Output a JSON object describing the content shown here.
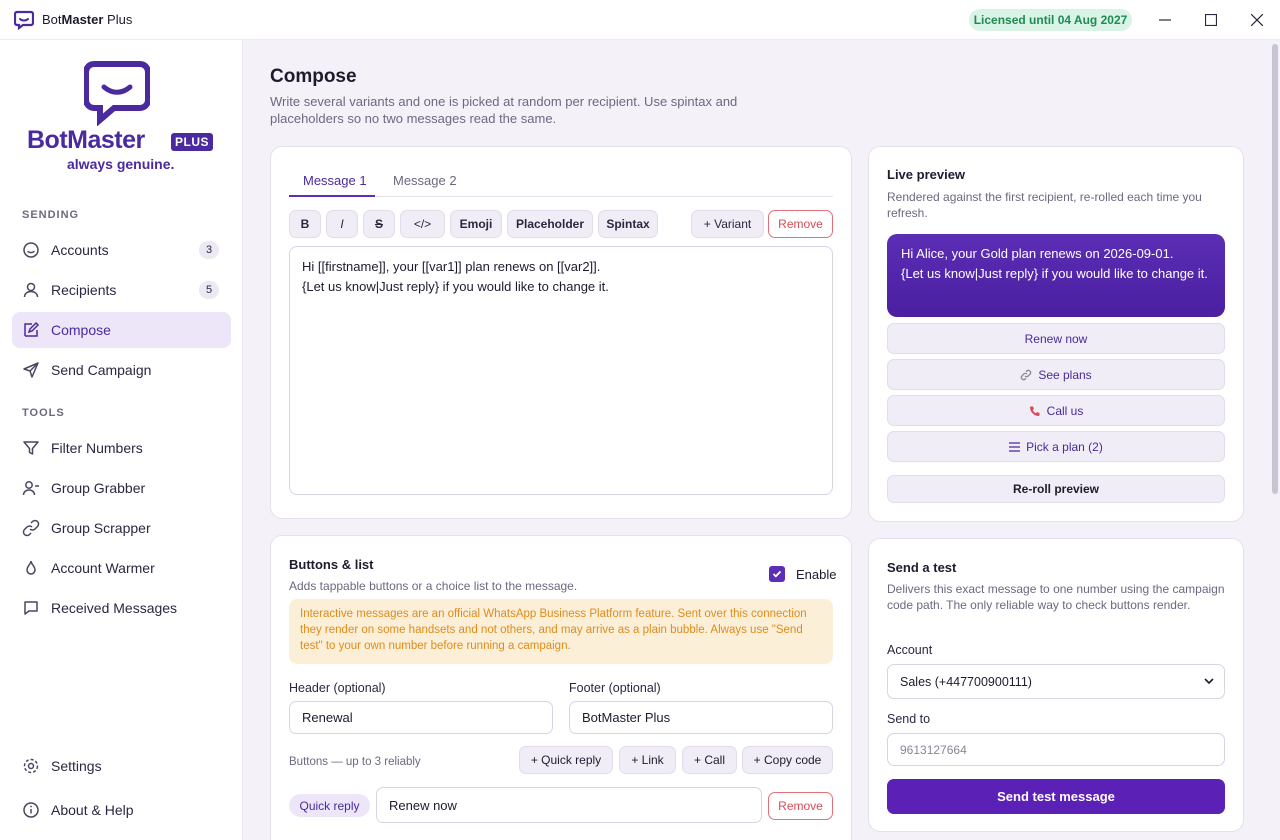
{
  "window": {
    "title_prefix": "Bot",
    "title_bold": "Master",
    "title_suffix": " Plus",
    "license": "Licensed until 04 Aug 2027"
  },
  "logo": {
    "name": "BotMaster",
    "plus": "PLUS",
    "tagline": "always genuine."
  },
  "sidebar": {
    "sending_label": "SENDING",
    "tools_label": "TOOLS",
    "sending": [
      {
        "label": "Accounts",
        "count": "3",
        "icon": "smiley-icon"
      },
      {
        "label": "Recipients",
        "count": "5",
        "icon": "user-icon"
      },
      {
        "label": "Compose",
        "icon": "pencil-icon",
        "active": true
      },
      {
        "label": "Send Campaign",
        "icon": "send-icon"
      }
    ],
    "tools": [
      {
        "label": "Filter Numbers",
        "icon": "funnel-icon"
      },
      {
        "label": "Group Grabber",
        "icon": "user-minus-icon"
      },
      {
        "label": "Group Scrapper",
        "icon": "link-icon"
      },
      {
        "label": "Account Warmer",
        "icon": "flame-icon"
      },
      {
        "label": "Received Messages",
        "icon": "message-icon"
      }
    ],
    "bottom": [
      {
        "label": "Settings",
        "icon": "gear-icon"
      },
      {
        "label": "About & Help",
        "icon": "info-icon"
      }
    ]
  },
  "compose": {
    "title": "Compose",
    "subtitle": "Write several variants and one is picked at random per recipient. Use spintax and placeholders so no two messages read the same.",
    "tabs": [
      "Message 1",
      "Message 2"
    ],
    "toolbar": {
      "bold": "B",
      "italic": "I",
      "strike": "S",
      "code": "</>",
      "emoji": "Emoji",
      "placeholder": "Placeholder",
      "spintax": "Spintax",
      "variant": "+ Variant",
      "remove": "Remove"
    },
    "message": "Hi [[firstname]], your [[var1]] plan renews on [[var2]].\n{Let us know|Just reply} if you would like to change it."
  },
  "preview": {
    "title": "Live preview",
    "subtitle": "Rendered against the first recipient, re-rolled each time you refresh.",
    "bubble": "Hi Alice, your Gold plan renews on 2026-09-01.\n{Let us know|Just reply} if you would like to change it.",
    "buttons": [
      {
        "label": "Renew now",
        "icon": ""
      },
      {
        "label": "See plans",
        "icon": "link-icon"
      },
      {
        "label": "Call us",
        "icon": "phone-icon"
      },
      {
        "label": "Pick a plan (2)",
        "icon": "list-icon"
      }
    ],
    "reroll": "Re-roll preview"
  },
  "buttons_list": {
    "title": "Buttons & list",
    "subtitle": "Adds tappable buttons or a choice list to the message.",
    "enable_label": "Enable",
    "enabled": true,
    "warning": "Interactive messages are an official WhatsApp Business Platform feature. Sent over this connection they render on some handsets and not others, and may arrive as a plain bubble. Always use \"Send test\" to your own number before running a campaign.",
    "header_label": "Header (optional)",
    "header_value": "Renewal",
    "footer_label": "Footer (optional)",
    "footer_value": "BotMaster Plus",
    "buttons_hint": "Buttons — up to 3 reliably",
    "add_quick_reply": "+ Quick reply",
    "add_link": "+ Link",
    "add_call": "+ Call",
    "add_copy_code": "+ Copy code",
    "rows": [
      {
        "type": "Quick reply",
        "value": "Renew now",
        "remove": "Remove"
      }
    ]
  },
  "send_test": {
    "title": "Send a test",
    "subtitle": "Delivers this exact message to one number using the campaign code path. The only reliable way to check buttons render.",
    "account_label": "Account",
    "account_value": "Sales (+447700900111)",
    "send_to_label": "Send to",
    "send_to_placeholder": "9613127664",
    "send_button": "Send test message"
  },
  "colors": {
    "accent": "#5b2eb5",
    "license_bg": "#d9f3e6",
    "license_fg": "#1f8a52",
    "warning_bg": "#fbefd8",
    "warning_fg": "#e08c1d",
    "danger": "#d94a57"
  }
}
